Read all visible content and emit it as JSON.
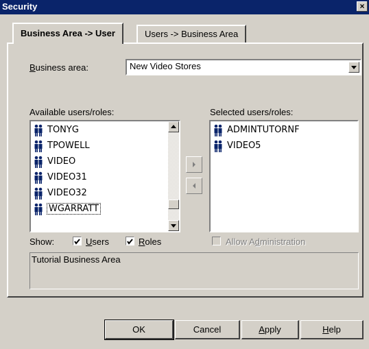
{
  "window": {
    "title": "Security",
    "close_glyph": "×"
  },
  "tabs": [
    {
      "label": "Business Area -> User",
      "active": true
    },
    {
      "label": "Users -> Business Area",
      "active": false
    }
  ],
  "business_area": {
    "label_mnemonic": "B",
    "label_rest": "usiness area:",
    "value": "New Video Stores"
  },
  "available": {
    "label": "Available users/roles:",
    "items": [
      "TONYG",
      "TPOWELL",
      "VIDEO",
      "VIDEO31",
      "VIDEO32",
      "WGARRATT"
    ]
  },
  "selected": {
    "label": "Selected users/roles:",
    "items": [
      "ADMINTUTORNF",
      "VIDEO5"
    ]
  },
  "show": {
    "label": "Show:",
    "users": {
      "mnemonic": "U",
      "rest": "sers",
      "checked": true
    },
    "roles": {
      "mnemonic": "R",
      "rest": "oles",
      "checked": true
    }
  },
  "allow_admin": {
    "pre": "Allow A",
    "mnemonic": "d",
    "rest": "ministration",
    "checked": false,
    "enabled": false
  },
  "description": "Tutorial Business Area",
  "buttons": {
    "ok": "OK",
    "cancel": "Cancel",
    "apply": {
      "mnemonic": "A",
      "rest": "pply"
    },
    "help": {
      "mnemonic": "H",
      "rest": "elp"
    }
  },
  "icons": {
    "user_icon": "users-icon",
    "add": "move-right-icon",
    "remove": "move-left-icon"
  },
  "colors": {
    "titlebar": "#0a246a",
    "face": "#d4d0c8",
    "icon_blue": "#0a246a"
  }
}
